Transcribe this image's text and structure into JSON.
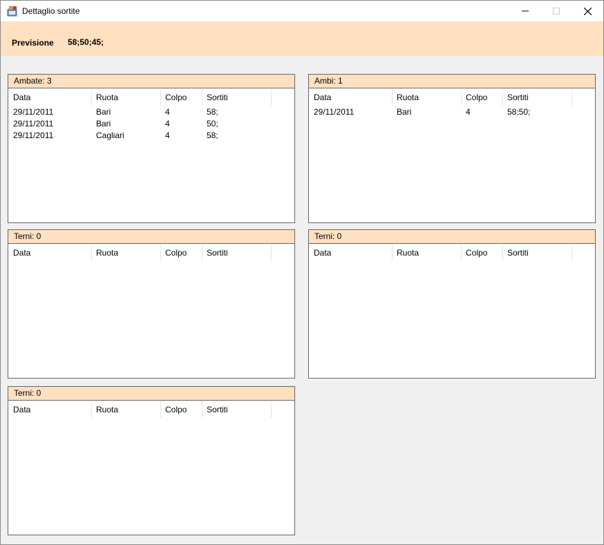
{
  "window": {
    "title": "Dettaglio sortite",
    "icon": "app-icon"
  },
  "header": {
    "label": "Previsione",
    "value": "58;50;45;"
  },
  "columns": [
    "Data",
    "Ruota",
    "Colpo",
    "Sortiti"
  ],
  "panels": [
    {
      "title": "Ambate: 3",
      "rows": [
        [
          "29/11/2011",
          "Bari",
          "4",
          "58;"
        ],
        [
          "29/11/2011",
          "Bari",
          "4",
          "50;"
        ],
        [
          "29/11/2011",
          "Cagliari",
          "4",
          "58;"
        ]
      ]
    },
    {
      "title": "Ambi: 1",
      "rows": [
        [
          "29/11/2011",
          "Bari",
          "4",
          "58;50;"
        ]
      ]
    },
    {
      "title": "Terni: 0",
      "rows": []
    },
    {
      "title": "Terni: 0",
      "rows": []
    },
    {
      "title": "Terni: 0",
      "rows": []
    }
  ],
  "colors": {
    "accent": "#ffe0c0",
    "border": "#646464",
    "background": "#f0f0f0"
  }
}
